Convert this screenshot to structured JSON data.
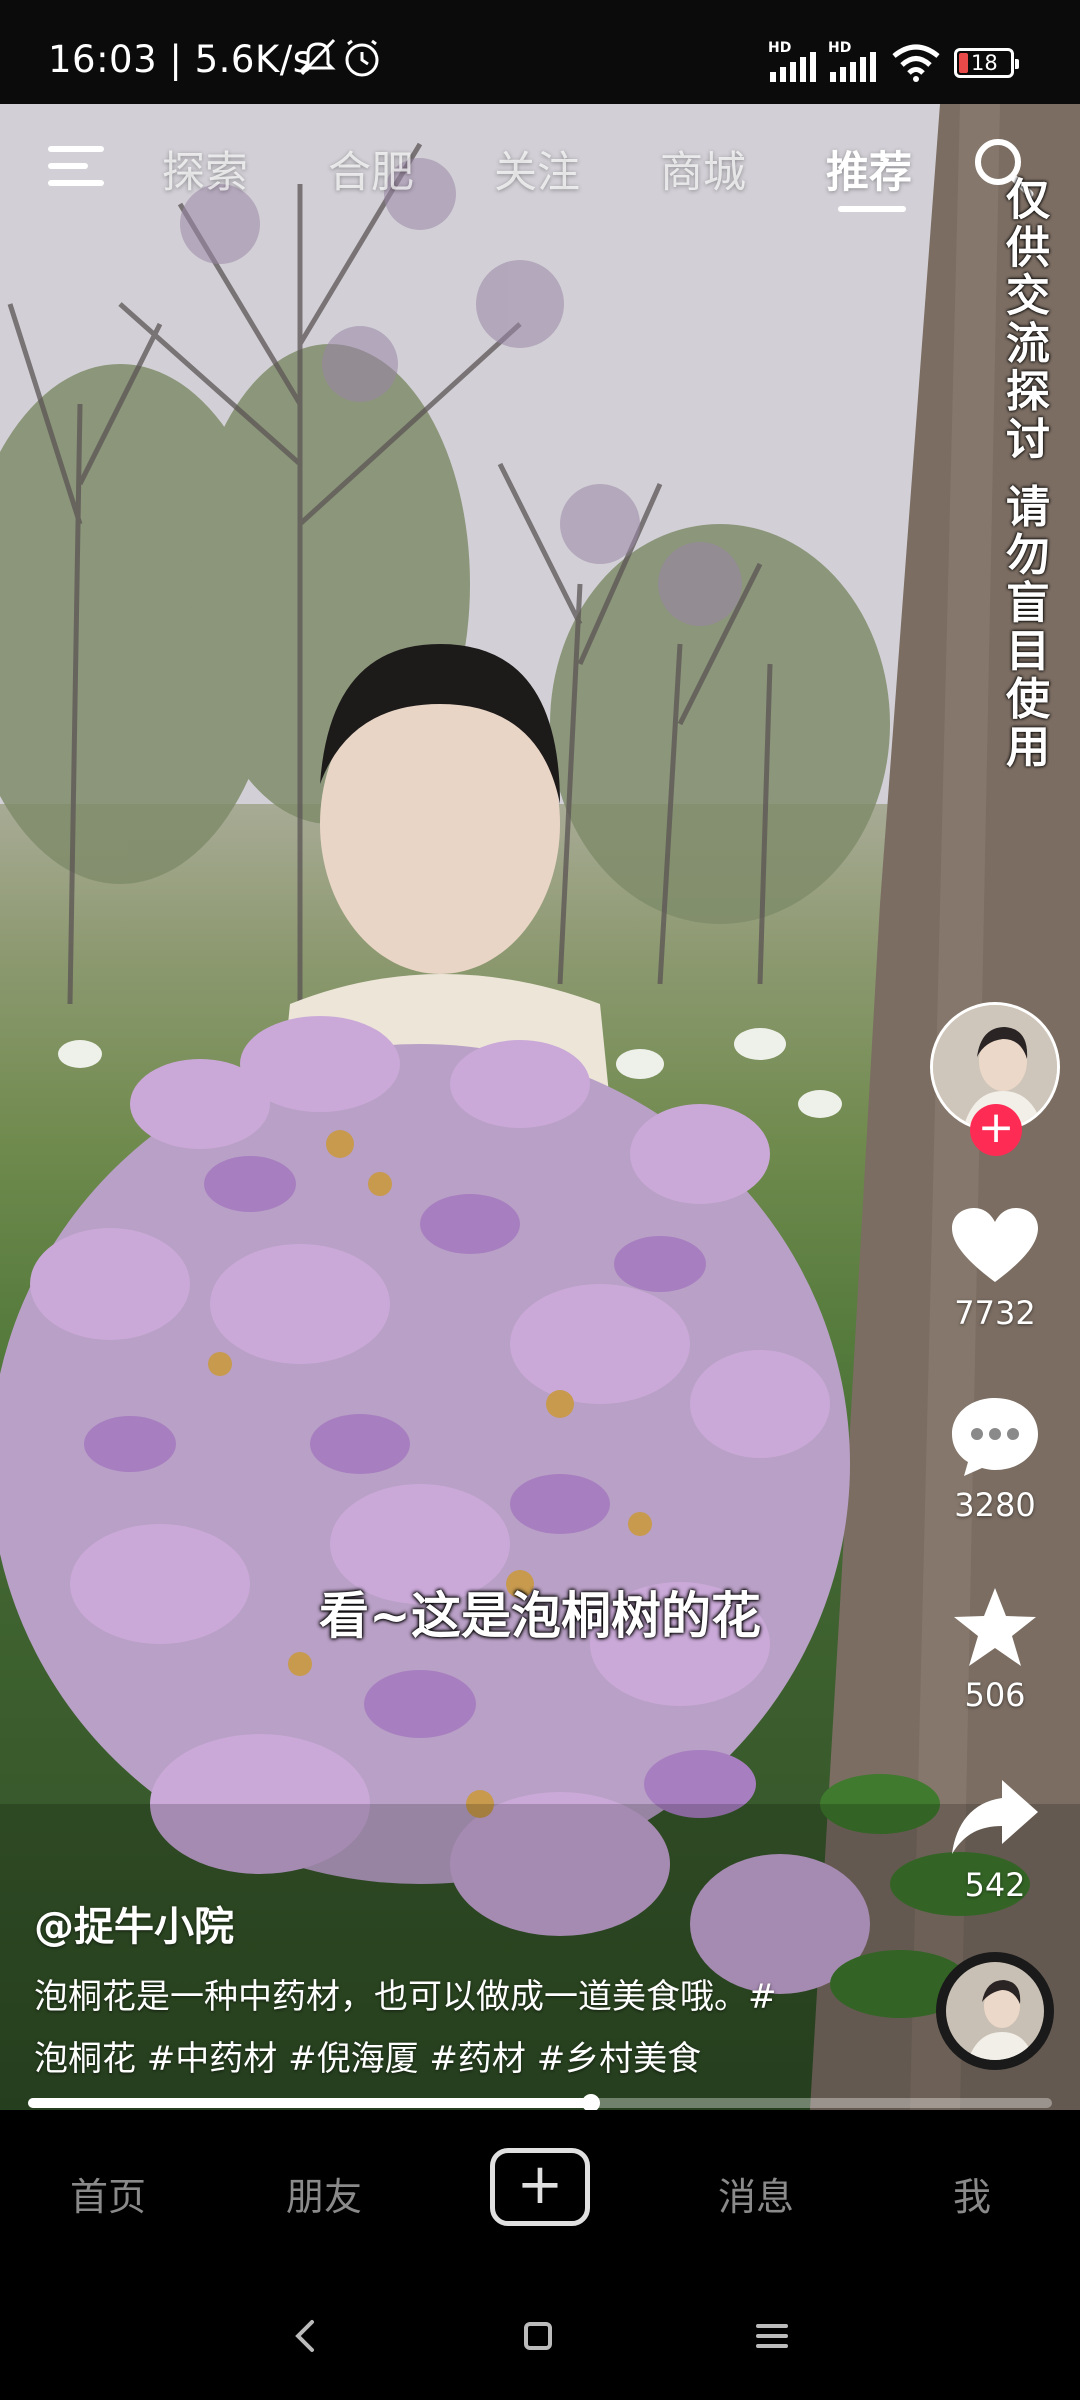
{
  "status_bar": {
    "time_speed": "16:03 | 5.6K/s",
    "hd1": "HD",
    "hd2": "HD",
    "battery": "18",
    "icons": [
      "mute-bell-icon",
      "alarm-icon",
      "signal-icon",
      "signal-icon",
      "wifi-icon",
      "battery-icon"
    ]
  },
  "top_nav": {
    "tabs": [
      {
        "label": "探索"
      },
      {
        "label": "合肥"
      },
      {
        "label": "关注"
      },
      {
        "label": "商城"
      },
      {
        "label": "推荐",
        "active": true
      }
    ]
  },
  "overlay": {
    "disclaimer": "仅供交流探讨 请勿盲目使用",
    "subtitle": "看~这是泡桐树的花"
  },
  "actions": {
    "like_count": "7732",
    "comment_count": "3280",
    "favorite_count": "506",
    "share_count": "542",
    "follow_symbol": "+"
  },
  "caption": {
    "author": "@捉牛小院",
    "description_line1": "泡桐花是一种中药材，也可以做成一道美食哦。#",
    "description_line2": "泡桐花 #中药材 #倪海厦 #药材 #乡村美食"
  },
  "progress": {
    "fraction": 0.55
  },
  "bottom_nav": {
    "home": "首页",
    "friends": "朋友",
    "create_symbol": "+",
    "messages": "消息",
    "me": "我"
  },
  "colors": {
    "accent": "#fe2c55",
    "inactive_nav": "#8a8a8a"
  }
}
